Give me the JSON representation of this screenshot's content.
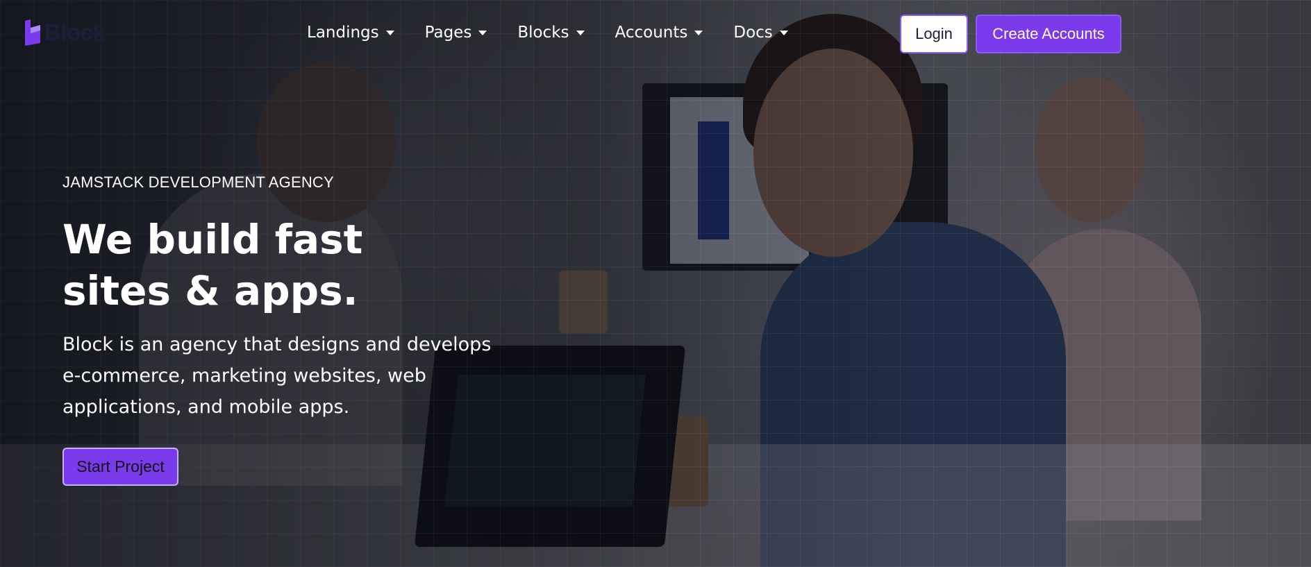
{
  "brand": {
    "name": "Block"
  },
  "nav": {
    "items": [
      {
        "label": "Landings"
      },
      {
        "label": "Pages"
      },
      {
        "label": "Blocks"
      },
      {
        "label": "Accounts"
      },
      {
        "label": "Docs"
      }
    ],
    "login_label": "Login",
    "create_label": "Create Accounts"
  },
  "hero": {
    "eyebrow": "JAMSTACK DEVELOPMENT AGENCY",
    "headline_line1": "We build fast",
    "headline_line2": "sites & apps.",
    "description": "Block is an agency that designs and develops e-commerce, marketing websites, web applications, and mobile apps.",
    "cta_label": "Start Project"
  },
  "colors": {
    "accent": "#7c3aed",
    "brand_text": "#1f1d3a"
  }
}
